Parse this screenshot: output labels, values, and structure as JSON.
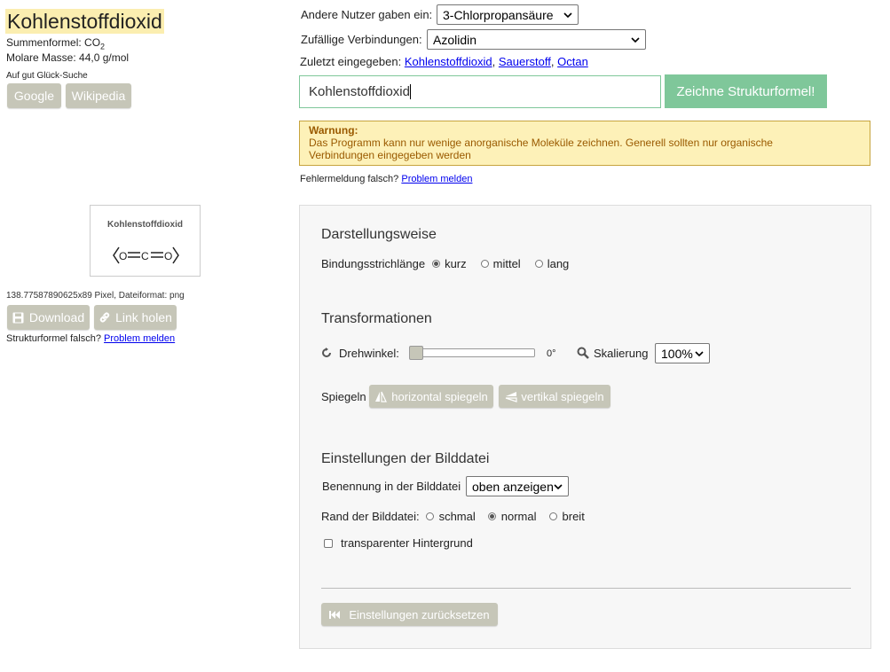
{
  "compound": {
    "name": "Kohlenstoffdioxid",
    "formula_label": "Summenformel: CO",
    "formula_sub": "2",
    "mass": "Molare Masse: 44,0 g/mol"
  },
  "search_luck": {
    "label": "Auf gut Glück-Suche",
    "google": "Google",
    "wikipedia": "Wikipedia"
  },
  "preview": {
    "title": "Kohlenstoffdioxid",
    "molecule": "O=C=O",
    "info": "138.77587890625x89 Pixel, Dateiformat: png",
    "download": "Download",
    "link": "Link holen",
    "wrong_label": "Strukturformel falsch?",
    "report": "Problem melden"
  },
  "top": {
    "others_label": "Andere Nutzer gaben ein:",
    "others_value": "3-Chlorpropansäure",
    "random_label": "Zufällige Verbindungen:",
    "random_value": "Azolidin",
    "recent_label": "Zuletzt eingegeben:",
    "recent": [
      "Kohlenstoffdioxid",
      "Sauerstoff",
      "Octan"
    ],
    "input_value": "Kohlenstoffdioxid",
    "draw_button": "Zeichne Strukturformel!"
  },
  "warning": {
    "title": "Warnung:",
    "text": "Das Programm kann nur wenige anorganische Moleküle zeichnen. Generell sollten nur organische Verbindungen eingegeben werden"
  },
  "error_report": {
    "label": "Fehlermeldung falsch?",
    "link": "Problem melden"
  },
  "settings": {
    "display_title": "Darstellungsweise",
    "bond_label": "Bindungsstrichlänge",
    "bond_options": [
      "kurz",
      "mittel",
      "lang"
    ],
    "bond_selected": 0,
    "transform_title": "Transformationen",
    "rotation_label": "Drehwinkel:",
    "rotation_value": "0°",
    "scale_label": "Skalierung",
    "scale_value": "100%",
    "mirror_label": "Spiegeln",
    "mirror_h": "horizontal spiegeln",
    "mirror_v": "vertikal spiegeln",
    "image_title": "Einstellungen der Bilddatei",
    "naming_label": "Benennung in der Bilddatei",
    "naming_value": "oben anzeigen",
    "border_label": "Rand der Bilddatei:",
    "border_options": [
      "schmal",
      "normal",
      "breit"
    ],
    "border_selected": 1,
    "transparent_label": "transparenter Hintergrund",
    "reset_button": "Einstellungen zurücksetzen"
  },
  "colors": {
    "title_highlight": "#fbeeb0",
    "draw_button": "#7fc79a",
    "grey_button": "#c6c6b8",
    "warning_bg": "#fdf1b8",
    "warning_border": "#c7a43e",
    "warning_text": "#9a5a00"
  }
}
